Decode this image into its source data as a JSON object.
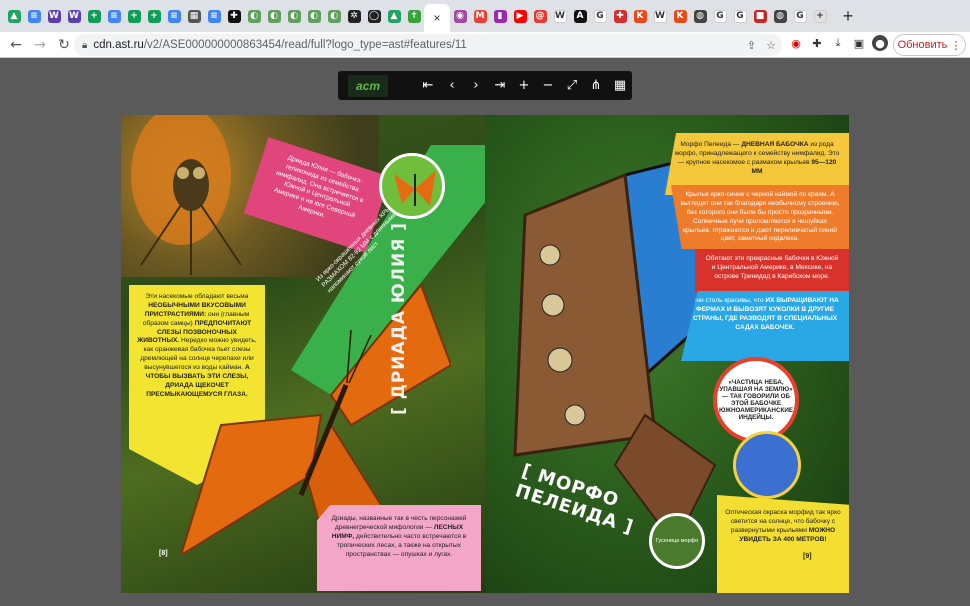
{
  "tabs": [
    {
      "icon": "drive-icon",
      "color": "#1fa463",
      "glyph": "▲"
    },
    {
      "icon": "docs-icon",
      "color": "#4285f4",
      "glyph": "≡"
    },
    {
      "icon": "word-icon",
      "color": "#5b3fb0",
      "glyph": "W"
    },
    {
      "icon": "word-icon",
      "color": "#5b3fb0",
      "glyph": "W"
    },
    {
      "icon": "sheets-icon",
      "color": "#0f9d58",
      "glyph": "+"
    },
    {
      "icon": "docs-icon",
      "color": "#4285f4",
      "glyph": "≡"
    },
    {
      "icon": "sheets-icon",
      "color": "#0f9d58",
      "glyph": "+"
    },
    {
      "icon": "sheets-icon",
      "color": "#0f9d58",
      "glyph": "+"
    },
    {
      "icon": "docs-icon",
      "color": "#4285f4",
      "glyph": "≡"
    },
    {
      "icon": "image-icon",
      "color": "#555555",
      "glyph": "▦"
    },
    {
      "icon": "docs-icon",
      "color": "#4285f4",
      "glyph": "≡"
    },
    {
      "icon": "plus-circle-icon",
      "color": "#111111",
      "glyph": "✚"
    },
    {
      "icon": "leaf-icon",
      "color": "#5fa05a",
      "glyph": "◐"
    },
    {
      "icon": "leaf-icon",
      "color": "#5fa05a",
      "glyph": "◐"
    },
    {
      "icon": "leaf-icon",
      "color": "#5fa05a",
      "glyph": "◐"
    },
    {
      "icon": "leaf-icon",
      "color": "#5fa05a",
      "glyph": "◐"
    },
    {
      "icon": "leaf-icon",
      "color": "#5fa05a",
      "glyph": "◐"
    },
    {
      "icon": "swirl-icon",
      "color": "#222222",
      "glyph": "✲"
    },
    {
      "icon": "oval-icon",
      "color": "#222222",
      "glyph": "◯"
    },
    {
      "icon": "drive-icon",
      "color": "#1fa463",
      "glyph": "▲"
    },
    {
      "icon": "ast-icon",
      "color": "#37a33a",
      "glyph": "✝"
    },
    {
      "icon": "close-icon",
      "color": "#ffffff",
      "glyph": "×",
      "active": true
    },
    {
      "icon": "podcast-icon",
      "color": "#a349a4",
      "glyph": "◉"
    },
    {
      "icon": "gmail-icon",
      "color": "#ea4335",
      "glyph": "M"
    },
    {
      "icon": "bookmark-icon",
      "color": "#9c27b0",
      "glyph": "▮"
    },
    {
      "icon": "youtube-icon",
      "color": "#ff0000",
      "glyph": "▶"
    },
    {
      "icon": "spiral-icon",
      "color": "#e53935",
      "glyph": "@"
    },
    {
      "icon": "wikipedia-icon",
      "color": "#ffffff",
      "glyph": "W"
    },
    {
      "icon": "delta-icon",
      "color": "#111111",
      "glyph": "A"
    },
    {
      "icon": "google-icon",
      "color": "#ffffff",
      "glyph": "G"
    },
    {
      "icon": "red-plus-icon",
      "color": "#d32f2f",
      "glyph": "✚"
    },
    {
      "icon": "k-icon",
      "color": "#e64a19",
      "glyph": "K"
    },
    {
      "icon": "wikipedia-icon",
      "color": "#ffffff",
      "glyph": "W"
    },
    {
      "icon": "k-icon",
      "color": "#e64a19",
      "glyph": "K"
    },
    {
      "icon": "globe-icon",
      "color": "#444444",
      "glyph": "◍"
    },
    {
      "icon": "google-icon",
      "color": "#ffffff",
      "glyph": "G"
    },
    {
      "icon": "google-icon",
      "color": "#ffffff",
      "glyph": "G"
    },
    {
      "icon": "stop-icon",
      "color": "#c62828",
      "glyph": "■"
    },
    {
      "icon": "globe-icon",
      "color": "#444444",
      "glyph": "◍"
    },
    {
      "icon": "g-dark-icon",
      "color": "#ffffff",
      "glyph": "G"
    },
    {
      "icon": "plus-box-icon",
      "color": "#e0e0e0",
      "glyph": "+"
    }
  ],
  "toolbar": {
    "url_host": "cdn.ast.ru",
    "url_path": "/v2/ASE000000000863454/read/full?logo_type=ast#features/11",
    "refresh_label": "Обновить"
  },
  "reader": {
    "logo_text": "аст"
  },
  "left_page": {
    "pink_box": "Дриада Юлия — бабочка-геликонида из семейства нимфалид. Она встречается в Южной и Центральной Америке и на юге Северной Америки.",
    "green_diag": "Из ярко-окрашенных дневных КРЫЛЬЯ РАЗМАХОМ 82-92 ММ с длинными вида напоминают сухой лист",
    "yellow_box_1": "Эти насекомые обладают весьма",
    "yellow_box_bold1": "НЕОБЫЧНЫМИ ВКУСОВЫМИ ПРИСТРАСТИЯМИ:",
    "yellow_box_2": "они (главным образом самцы)",
    "yellow_box_bold2": "ПРЕДПОЧИТАЮТ СЛЕЗЫ ПОЗВОНОЧНЫХ ЖИВОТНЫХ.",
    "yellow_box_3": "Нередко можно увидеть, как оранжевая бабочка пьет слезы дремлющей на солнце черепахи или высунувшегося из воды кайман.",
    "yellow_box_bold3": "А ЧТОБЫ ВЫЗВАТЬ ЭТИ СЛЕЗЫ, ДРИАДА ЩЕКОЧЕТ ПРЕСМЫКАЮЩЕМУСЯ ГЛАЗА.",
    "title": "[ ДРИАДА ЮЛИЯ ]",
    "pink_bottom_1": "Дриады, названные так в честь персонажей древнегреческой мифологии —",
    "pink_bottom_bold": "ЛЕСНЫХ НИМФ,",
    "pink_bottom_2": "действительно часто встречаются в тропических лесах, а также на открытых пространствах — опушках и лугах.",
    "page_num": "[8]"
  },
  "right_page": {
    "yellow_top_1": "Морфо Пелеида —",
    "yellow_top_bold": "ДНЕВНАЯ БАБОЧКА",
    "yellow_top_2": "из рода морфо, принадлежащего к семейству нимфалид. Это — крупное насекомое с размахом крыльев",
    "yellow_top_bold2": "95—120 ММ",
    "orange_box": "Крылья ярко-синие с черной каймой по краям. А выглядят они так благодаря необычному строению, без которого они были бы просто прозрачными. Солнечные лучи преломляются в чешуйках крыльев, отражаются и дают переливчатый синий цвет, заметный издалека.",
    "red_box": "Обитают эти прекрасные бабочки в Южной и Центральной Америке, в Мексике, на острове Тринидад в Карибском море.",
    "blue_box_1": "Они столь красивы, что",
    "blue_box_bold": "ИХ ВЫРАЩИВАЮТ НА ФЕРМАХ И ВЫВОЗЯТ КУКОЛКИ В ДРУГИЕ СТРАНЫ, ГДЕ РАЗВОДЯТ В СПЕЦИАЛЬНЫХ САДАХ БАБОЧЕК.",
    "circle_quote": "«ЧАСТИЦА НЕБА, УПАВШАЯ НА ЗЕМЛЮ» — ТАК ГОВОРИЛИ ОБ ЭТОЙ БАБОЧКЕ ЮЖНОАМЕРИКАНСКИЕ ИНДЕЙЦЫ.",
    "title": "[ МОРФО ПЕЛЕИДА ]",
    "small_circle_text": "Гусеница морфо",
    "yellow_bottom_1": "Оптическая окраска морфид так ярко светится на солнце, что бабочку с развернутыми крыльями",
    "yellow_bottom_bold": "МОЖНО УВИДЕТЬ ЗА 400 МЕТРОВ!",
    "page_num": "[9]"
  }
}
